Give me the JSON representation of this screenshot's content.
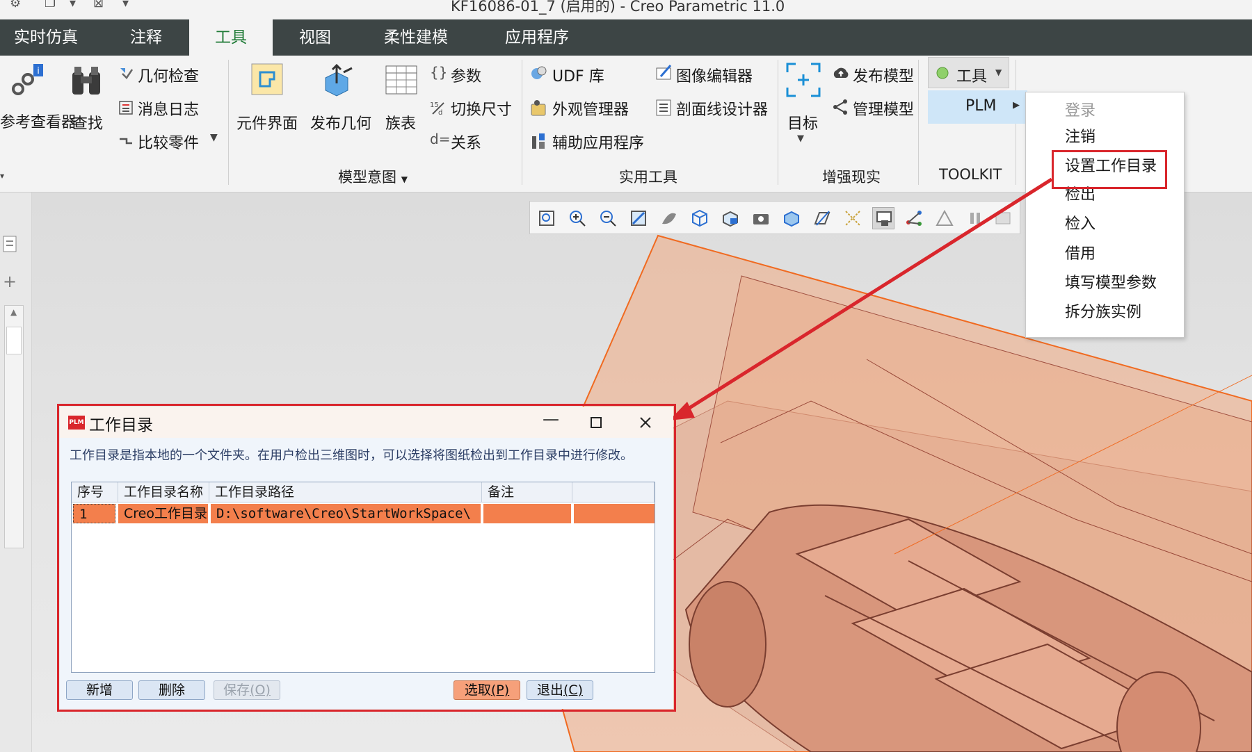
{
  "window": {
    "title": "KF16086-01_7 (启用的) - Creo Parametric 11.0"
  },
  "tabs": [
    {
      "label": "实时仿真"
    },
    {
      "label": "注释"
    },
    {
      "label": "工具"
    },
    {
      "label": "视图"
    },
    {
      "label": "柔性建模"
    },
    {
      "label": "应用程序"
    }
  ],
  "ribbon": {
    "investigate": {
      "ref_viewer": "参考查看器",
      "find": "查找",
      "geom_check": "几何检查",
      "message_log": "消息日志",
      "compare_part": "比较零件"
    },
    "model_intent": {
      "component_interface": "元件界面",
      "publish_geometry": "发布几何",
      "family_table": "族表",
      "parameters": "参数",
      "switch_dimensions": "切换尺寸",
      "relations": "关系",
      "group_label": "模型意图"
    },
    "utilities": {
      "udf_library": "UDF 库",
      "appearance_manager": "外观管理器",
      "aux_applications": "辅助应用程序",
      "image_editor": "图像编辑器",
      "hatch_designer": "剖面线设计器",
      "group_label": "实用工具"
    },
    "ar": {
      "target": "目标",
      "publish_model": "发布模型",
      "manage_model": "管理模型",
      "group_label": "增强现实"
    },
    "toolkit": {
      "tools": "工具",
      "plm": "PLM",
      "group_label": "TOOLKIT"
    }
  },
  "plm_menu": {
    "items": [
      {
        "label": "登录",
        "disabled": true
      },
      {
        "label": "注销",
        "disabled": false
      },
      {
        "label": "设置工作目录",
        "disabled": false
      },
      {
        "label": "检出",
        "disabled": false
      },
      {
        "label": "检入",
        "disabled": false
      },
      {
        "label": "借用",
        "disabled": false
      },
      {
        "label": "填写模型参数",
        "disabled": false
      },
      {
        "label": "拆分族实例",
        "disabled": false
      }
    ]
  },
  "dialog": {
    "logo": "PLM",
    "title": "工作目录",
    "description": "工作目录是指本地的一个文件夹。在用户检出三维图时，可以选择将图纸检出到工作目录中进行修改。",
    "columns": [
      "序号",
      "工作目录名称",
      "工作目录路径",
      "备注"
    ],
    "rows": [
      {
        "index": "1",
        "name": "Creo工作目录",
        "path": "D:\\software\\Creo\\StartWorkSpace\\",
        "note": ""
      }
    ],
    "buttons": {
      "add": "新增",
      "delete": "删除",
      "save": "保存",
      "save_key": "(O)",
      "select": "选取",
      "select_key": "(P)",
      "exit": "退出",
      "exit_key": "(C)"
    }
  },
  "colors": {
    "accent_red": "#d9262c",
    "selection_orange": "#f37f4c",
    "tab_bar": "#3d4545",
    "active_tab_text": "#1f7a36",
    "model_copper": "#e8a78a"
  }
}
